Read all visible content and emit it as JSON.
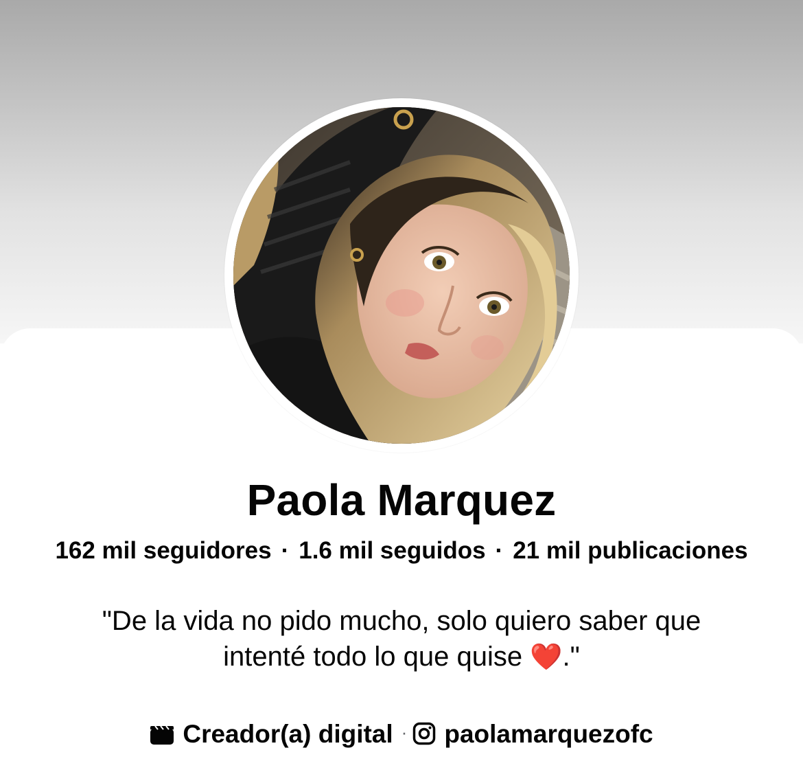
{
  "profile": {
    "name": "Paola Marquez",
    "stats": {
      "followers": "162 mil seguidores",
      "following": "1.6 mil seguidos",
      "posts": "21 mil publicaciones",
      "separator": "·"
    },
    "bio_line1": "\"De la vida no pido mucho, solo quiero saber que",
    "bio_line2_text": "intenté todo lo que quise ",
    "bio_heart": "❤️",
    "bio_line2_end": ".\"",
    "category_icon": "clapperboard-icon",
    "category": "Creador(a) digital",
    "details_separator": "·",
    "instagram_icon": "instagram-icon",
    "instagram_handle": "paolamarquezofc"
  },
  "colors": {
    "text": "#050505",
    "heart": "#e0242b",
    "cover_top": "#a9a9a9",
    "cover_bottom": "#f6f6f6"
  }
}
